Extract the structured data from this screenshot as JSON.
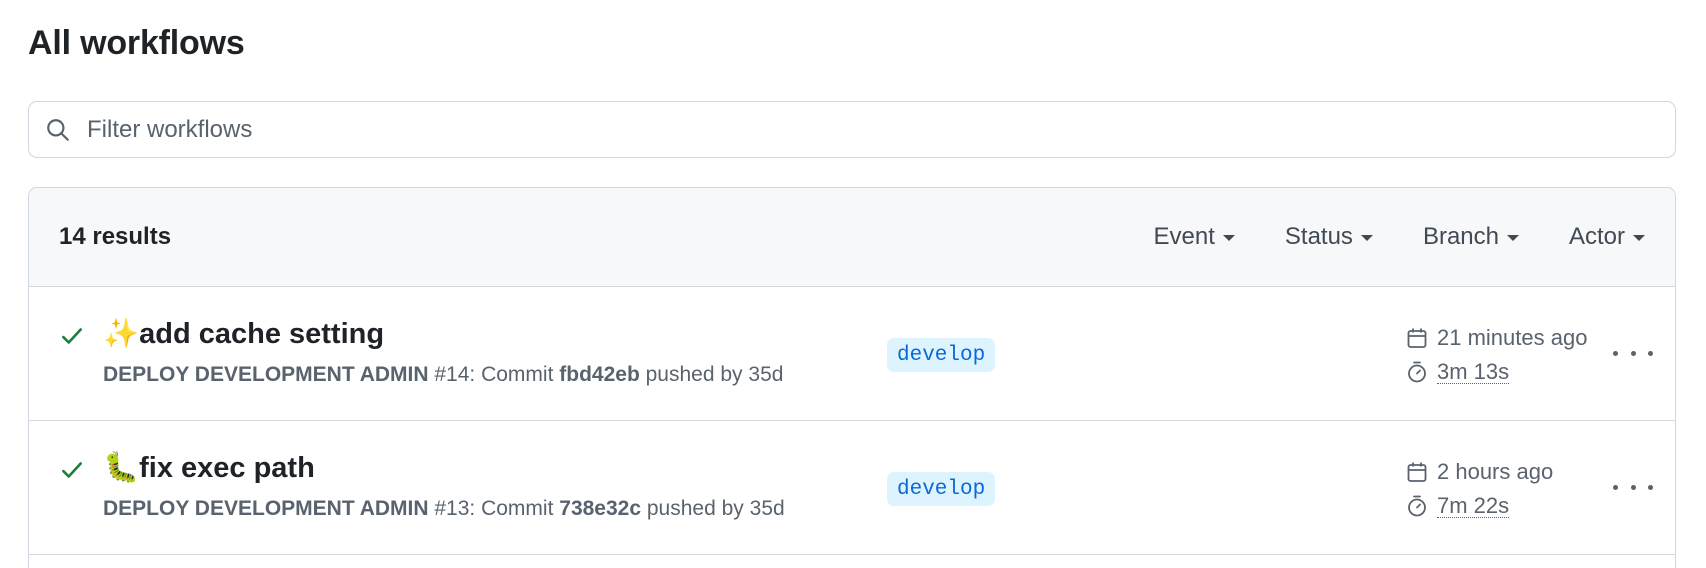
{
  "page": {
    "title": "All workflows"
  },
  "search": {
    "placeholder": "Filter workflows",
    "value": ""
  },
  "results": {
    "count_label": "14 results",
    "filters": [
      "Event",
      "Status",
      "Branch",
      "Actor"
    ]
  },
  "runs": [
    {
      "status": "success",
      "title": "✨add cache setting",
      "workflow": "DEPLOY DEVELOPMENT ADMIN",
      "run_number": "#14",
      "commit_prefix": ": Commit",
      "sha": "fbd42eb",
      "pushed_by_label": "pushed by",
      "actor": "35d",
      "branch": "develop",
      "time_ago": "21 minutes ago",
      "duration": "3m 13s"
    },
    {
      "status": "success",
      "title": "🐛fix exec path",
      "workflow": "DEPLOY DEVELOPMENT ADMIN",
      "run_number": "#13",
      "commit_prefix": ": Commit",
      "sha": "738e32c",
      "pushed_by_label": "pushed by",
      "actor": "35d",
      "branch": "develop",
      "time_ago": "2 hours ago",
      "duration": "7m 22s"
    }
  ],
  "colors": {
    "success": "#1a7f37",
    "branch_bg": "#ddf4ff",
    "branch_fg": "#0969da",
    "border": "#d0d7de",
    "header_bg": "#f6f8fa"
  }
}
